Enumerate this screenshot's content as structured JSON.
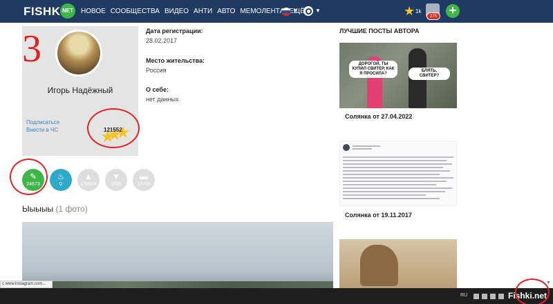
{
  "header": {
    "logo": "FISHKI",
    "logo_badge": "NET",
    "nav": [
      "НОВОЕ",
      "СООБЩЕСТВА",
      "ВИДЕО",
      "АНТИ",
      "АВТО",
      "МЕМОЛЕНТА",
      "ЕЩЁ"
    ],
    "stars_count": "1k",
    "notifications": "275"
  },
  "profile": {
    "annotation_number": "3",
    "name": "Игорь Надёжный",
    "subscribe_label": "Подписаться",
    "blacklist_label": "Внести в ЧС",
    "rating": "121552"
  },
  "info": {
    "reg_label": "Дата регистрации:",
    "reg_value": "28.02.2017",
    "location_label": "Место жительства:",
    "location_value": "Россия",
    "about_label": "О себе:",
    "about_value": "нет данных"
  },
  "stats": [
    {
      "icon": "pencil-icon",
      "value": "24673"
    },
    {
      "icon": "fire-icon",
      "value": "0"
    },
    {
      "icon": "thumbs-up-icon",
      "value": "170604"
    },
    {
      "icon": "thumbs-down-icon",
      "value": "1636"
    },
    {
      "icon": "comment-icon",
      "value": "10765"
    }
  ],
  "album": {
    "title": "Ыыыыы",
    "count": "(1 фото)"
  },
  "best_posts": {
    "title": "ЛУЧШИЕ ПОСТЫ АВТОРА",
    "posts": [
      {
        "caption": "Солянка от 27.04.2022",
        "bubble_left": "ДОРОГОЙ, ТЫ КУПИЛ СВИТЕР, КАК Я ПРОСИЛА?",
        "bubble_right": "БЛЯТЬ, СВИТЕР?"
      },
      {
        "caption": "Солянка от 19.11.2017"
      }
    ]
  },
  "statusbar": {
    "url": "c www.instagram.com..."
  },
  "taskbar": {
    "lang": "RU",
    "watermark": "Fishki.net"
  },
  "colors": {
    "header_bg": "#1f3a63",
    "accent_green": "#3eb549",
    "annotation_red": "#e22020",
    "star_yellow": "#f6c325"
  }
}
